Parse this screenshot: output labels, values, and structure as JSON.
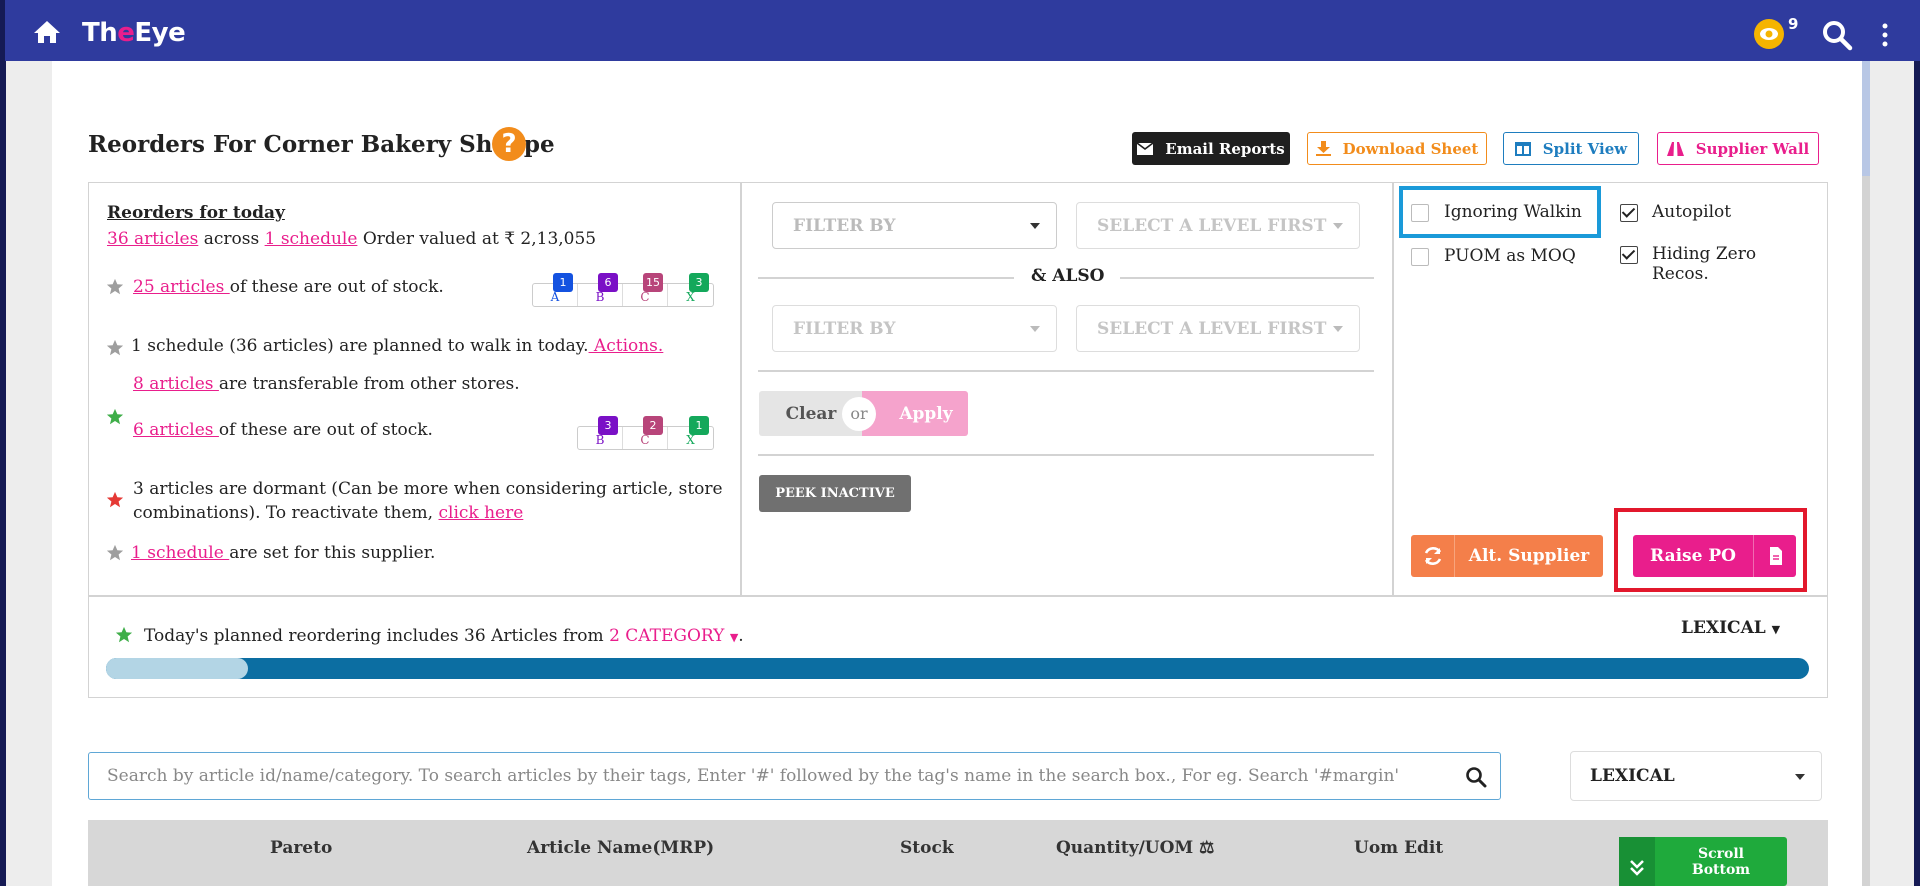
{
  "app": {
    "logo_part1": "Th",
    "logo_part2": "e",
    "logo_part3": "Eye",
    "notification_count": "9"
  },
  "page": {
    "title": "Reorders For Corner Bakery Shoppe",
    "help_label": "?"
  },
  "actions": {
    "email": "Email Reports",
    "download": "Download Sheet",
    "split": "Split View",
    "supplier_wall": "Supplier Wall"
  },
  "summary": {
    "heading": "Reorders for today",
    "line1_articles": "36 articles",
    "line1_across": "across",
    "line1_schedule": "1 schedule",
    "line1_value": "Order valued at ₹ 2,13,055",
    "oos_link": "25 articles ",
    "oos_text": "of these are out of stock.",
    "pareto1": [
      {
        "label": "A",
        "count": "1",
        "color": "#1452e0"
      },
      {
        "label": "B",
        "count": "6",
        "color": "#7a10c6"
      },
      {
        "label": "C",
        "count": "15",
        "color": "#b8457a"
      },
      {
        "label": "X",
        "count": "3",
        "color": "#14a85b"
      }
    ],
    "walk_text": "1 schedule (36 articles) are planned to walk in today.",
    "walk_link": " Actions.",
    "transfer_link": "8 articles ",
    "transfer_text": "are transferable from other stores.",
    "oos2_link": "6 articles ",
    "oos2_text": "of these are out of stock.",
    "pareto2": [
      {
        "label": "B",
        "count": "3",
        "color": "#7a10c6"
      },
      {
        "label": "C",
        "count": "2",
        "color": "#b8457a"
      },
      {
        "label": "X",
        "count": "1",
        "color": "#14a85b"
      }
    ],
    "dormant_text1": "3 articles are dormant (Can be more when considering article, store",
    "dormant_text2": "combinations). To reactivate them,",
    "dormant_link": "click here",
    "sched_link": "1 schedule ",
    "sched_text": "are set for this supplier."
  },
  "filters": {
    "filter_by_1": "FILTER BY",
    "level_1": "SELECT A LEVEL FIRST",
    "also": "& ALSO",
    "filter_by_2": "FILTER BY",
    "level_2": "SELECT A LEVEL FIRST",
    "clear": "Clear",
    "or": "or",
    "apply": "Apply",
    "peek": "PEEK INACTIVE"
  },
  "options": {
    "ignoring_walkin": {
      "label": "Ignoring Walkin",
      "checked": false
    },
    "autopilot": {
      "label": "Autopilot",
      "checked": true
    },
    "puom_moq": {
      "label": "PUOM as MOQ",
      "checked": false
    },
    "hiding_zero_1": "Hiding Zero",
    "hiding_zero_2": "Recos."
  },
  "buttons": {
    "alt_supplier": "Alt. Supplier",
    "raise_po": "Raise PO"
  },
  "plan": {
    "text": "Today's planned reordering includes 36 Articles from",
    "category_link": "2 CATEGORY",
    "period": ".",
    "sort": "LEXICAL",
    "progress_fraction": 0.083
  },
  "search": {
    "placeholder": "Search by article id/name/category. To search articles by their tags, Enter '#' followed by the tag's name in the search box., For eg. Search '#margin'",
    "sort_value": "LEXICAL"
  },
  "table": {
    "headers": [
      "Pareto",
      "Article Name(MRP)",
      "Stock",
      "Quantity/UOM ⚖",
      "Uom Edit"
    ],
    "scroll_bottom_1": "Scroll",
    "scroll_bottom_2": "Bottom"
  },
  "colors": {
    "nav": "#2f3b9e",
    "accent": "#e91e8c",
    "orange": "#f28c1b",
    "blue": "#1e7dbf",
    "bar": "#0c6ea2"
  }
}
